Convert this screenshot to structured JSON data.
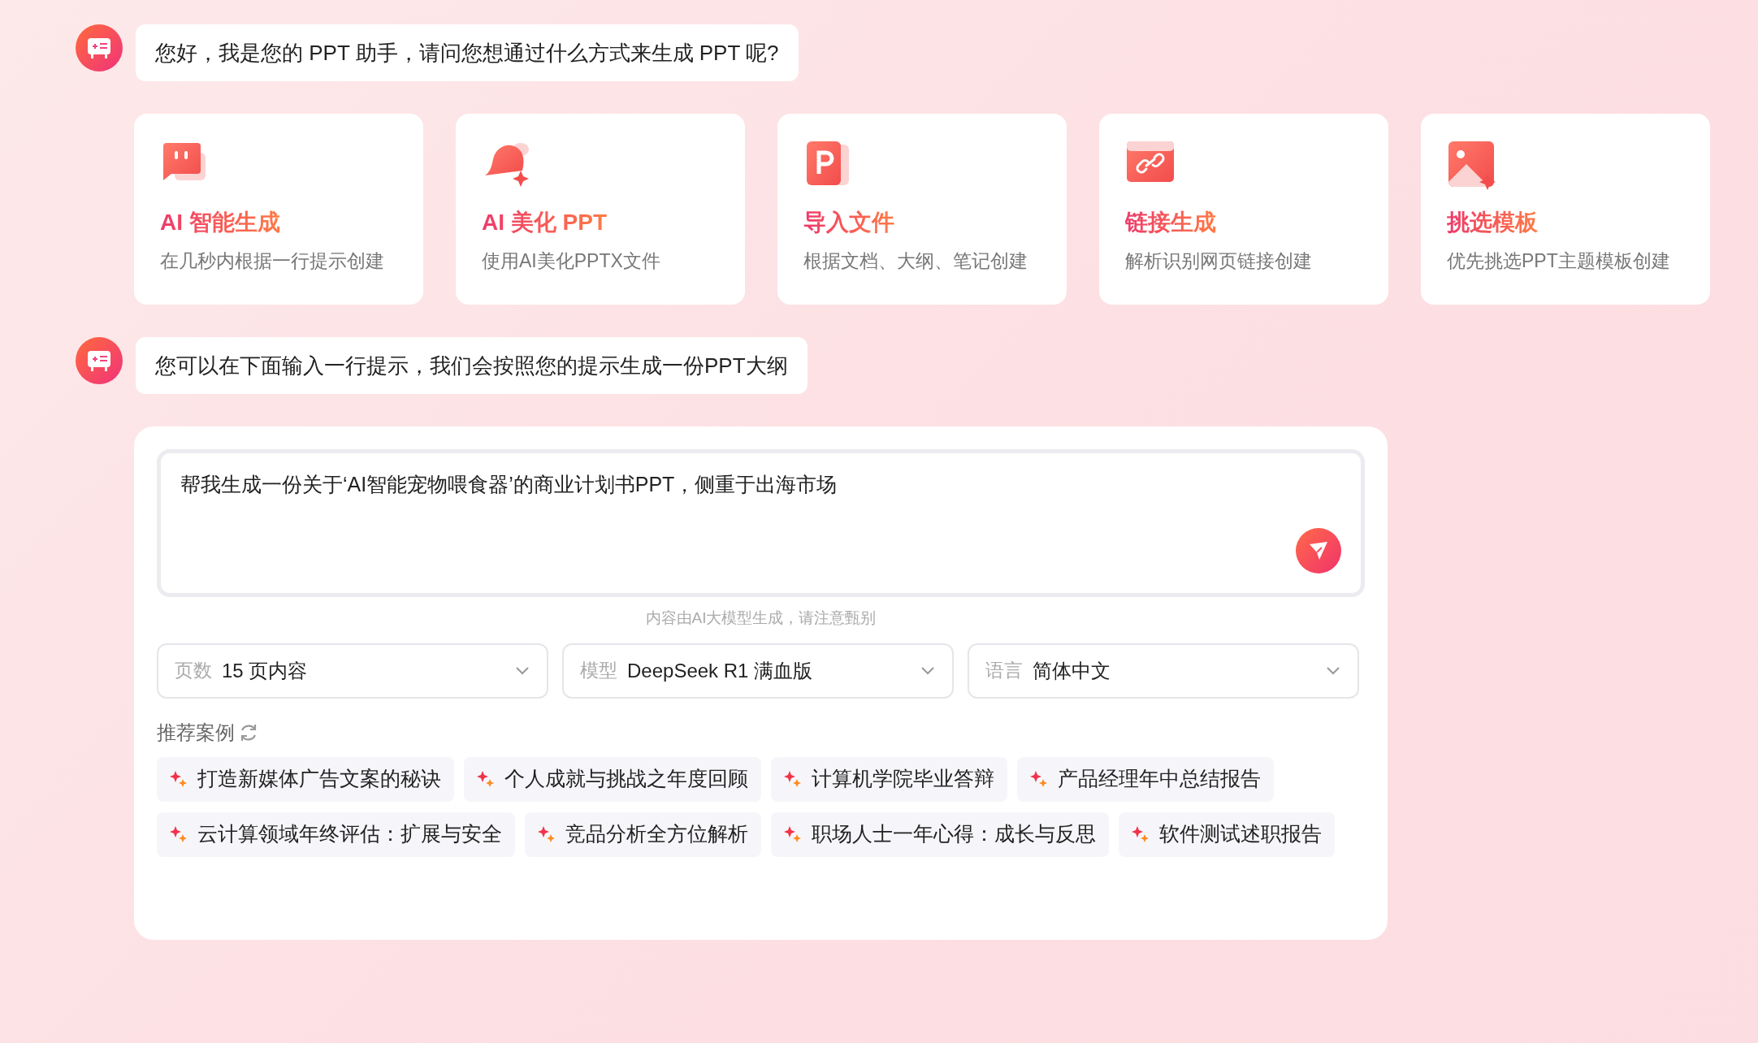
{
  "messages": [
    {
      "text": "您好，我是您的 PPT 助手，请问您想通过什么方式来生成 PPT 呢?"
    },
    {
      "text": "您可以在下面输入一行提示，我们会按照您的提示生成一份PPT大纲"
    }
  ],
  "modes": [
    {
      "kind": "chat",
      "title": "AI 智能生成",
      "description": "在几秒内根据一行提示创建"
    },
    {
      "kind": "bell",
      "title": "AI 美化 PPT",
      "description": "使用AI美化PPTX文件"
    },
    {
      "kind": "file",
      "title": "导入文件",
      "description": "根据文档、大纲、笔记创建"
    },
    {
      "kind": "link",
      "title": "链接生成",
      "description": "解析识别网页链接创建"
    },
    {
      "kind": "image",
      "title": "挑选模板",
      "description": "优先挑选PPT主题模板创建"
    }
  ],
  "prompt": {
    "value": "帮我生成一份关于‘AI智能宠物喂食器’的商业计划书PPT，侧重于出海市场"
  },
  "disclaimer": "内容由AI大模型生成，请注意甄别",
  "selects": [
    {
      "label": "页数",
      "value": "15 页内容"
    },
    {
      "label": "模型",
      "value": "DeepSeek R1 满血版"
    },
    {
      "label": "语言",
      "value": "简体中文"
    }
  ],
  "examples": {
    "title": "推荐案例",
    "items": [
      "打造新媒体广告文案的秘诀",
      "个人成就与挑战之年度回顾",
      "计算机学院毕业答辩",
      "产品经理年中总结报告",
      "云计算领域年终评估：扩展与安全",
      "竞品分析全方位解析",
      "职场人士一年心得：成长与反思",
      "软件测试述职报告"
    ]
  }
}
